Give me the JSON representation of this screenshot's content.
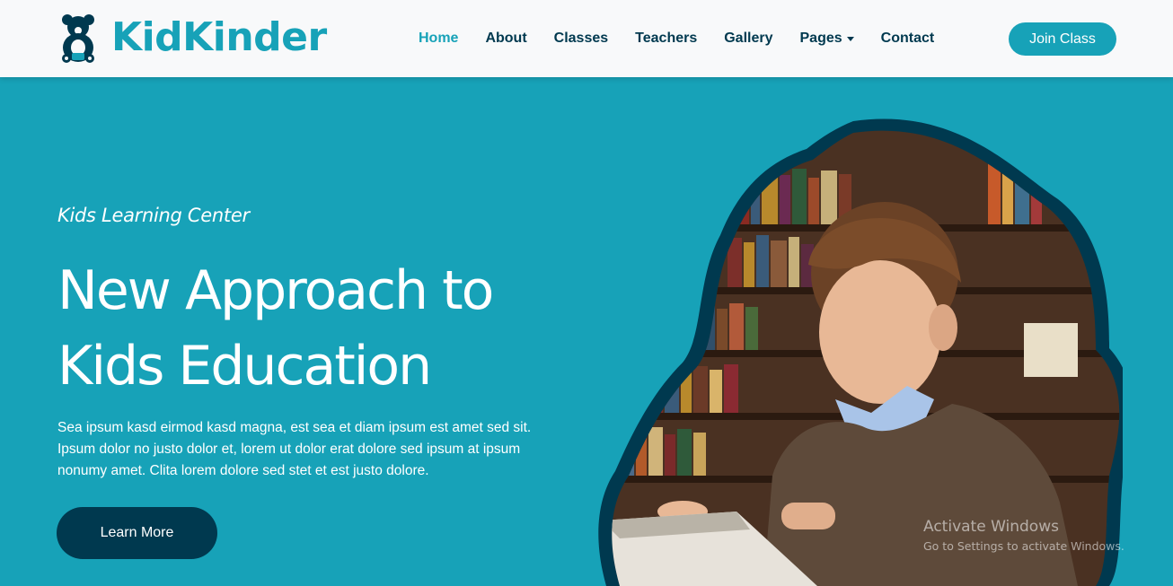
{
  "brand": {
    "name": "KidKinder",
    "logo_icon": "teddy-bear-icon"
  },
  "nav": {
    "items": [
      {
        "label": "Home",
        "active": true
      },
      {
        "label": "About"
      },
      {
        "label": "Classes"
      },
      {
        "label": "Teachers"
      },
      {
        "label": "Gallery"
      },
      {
        "label": "Pages",
        "dropdown": true
      },
      {
        "label": "Contact"
      }
    ],
    "cta_label": "Join Class"
  },
  "hero": {
    "subtitle": "Kids Learning Center",
    "title_line1": "New Approach to",
    "title_line2": "Kids Education",
    "text": "Sea ipsum kasd eirmod kasd magna, est sea et diam ipsum est amet sed sit. Ipsum dolor no justo dolor et, lorem ut dolor erat dolore sed ipsum at ipsum nonumy amet. Clita lorem dolore sed stet et est justo dolore.",
    "button_label": "Learn More"
  },
  "watermark": {
    "title": "Activate Windows",
    "subtitle": "Go to Settings to activate Windows."
  },
  "colors": {
    "primary": "#17a2b8",
    "secondary": "#00394f",
    "navbar_bg": "#f8f9fa",
    "white": "#ffffff"
  }
}
